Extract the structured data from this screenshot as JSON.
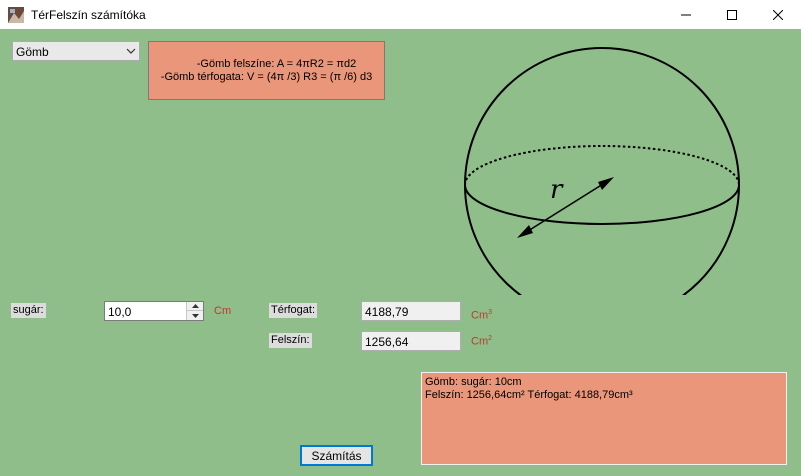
{
  "window": {
    "title": "TérFelszín számítóka"
  },
  "shape_select": {
    "value": "Gömb"
  },
  "formula": {
    "line1": "-Gömb felszíne: A = 4πR2 = πd2",
    "line2": "-Gömb térfogata: V = (4π /3) R3 = (π /6) d3"
  },
  "diagram": {
    "radius_label": "r"
  },
  "radius": {
    "label": "sugár:",
    "value": "10,0",
    "unit": "Cm"
  },
  "volume": {
    "label": "Térfogat:",
    "value": "4188,79",
    "unit": "Cm",
    "unit_sup": "3"
  },
  "surface": {
    "label": "Felszín:",
    "value": "1256,64",
    "unit": "Cm",
    "unit_sup": "2"
  },
  "result": {
    "line1": "Gömb: sugár: 10cm",
    "line2": "Felszín: 1256,64cm² Térfogat: 4188,79cm³"
  },
  "calc_button": {
    "label": "Számítás"
  },
  "colors": {
    "background": "#8fbe8b",
    "panel": "#e9967a",
    "unit_text": "#c0392b",
    "focus": "#0078d7"
  }
}
